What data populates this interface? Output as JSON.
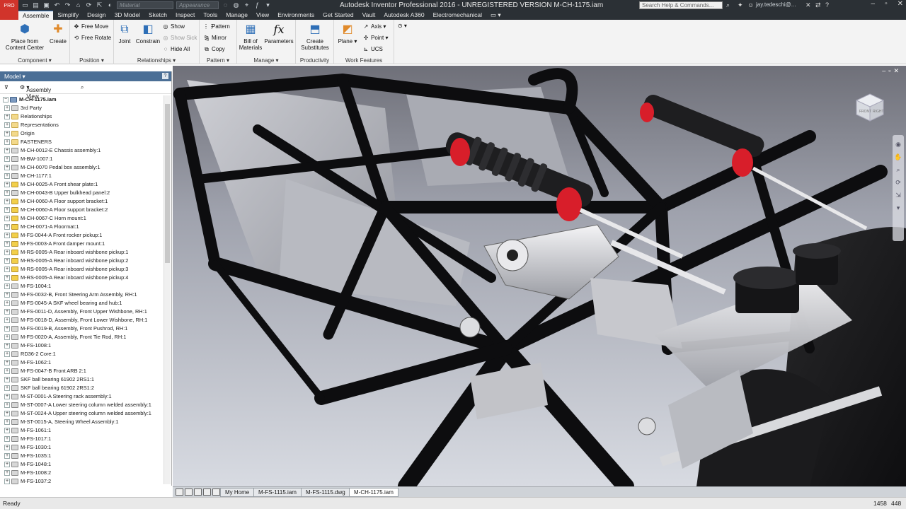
{
  "title_bar": {
    "app_title": "Autodesk Inventor Professional 2016 - UNREGISTERED VERSION    M-CH-1175.iam",
    "logo_text": "PRO",
    "material_placeholder": "Material",
    "appearance_placeholder": "Appearance",
    "help_search_placeholder": "Search Help & Commands...",
    "user_name": "jay.tedeschi@...",
    "help_label": "?"
  },
  "ribbon_tabs": [
    "Assemble",
    "Simplify",
    "Design",
    "3D Model",
    "Sketch",
    "Inspect",
    "Tools",
    "Manage",
    "View",
    "Environments",
    "Get Started",
    "Vault",
    "Autodesk A360",
    "Electromechanical"
  ],
  "ribbon": {
    "component": {
      "title": "Component",
      "place_label": "Place from\nContent Center",
      "create_label": "Create"
    },
    "position": {
      "title": "Position",
      "free_move": "Free Move",
      "free_rotate": "Free Rotate"
    },
    "relationships": {
      "title": "Relationships",
      "joint": "Joint",
      "constrain": "Constrain",
      "show": "Show",
      "show_sick": "Show Sick",
      "hide_all": "Hide All"
    },
    "pattern": {
      "title": "Pattern",
      "pattern": "Pattern",
      "mirror": "Mirror",
      "copy": "Copy"
    },
    "manage": {
      "title": "Manage",
      "bom": "Bill of\nMaterials",
      "parameters": "Parameters"
    },
    "productivity": {
      "title": "Productivity",
      "create_substitutes": "Create\nSubstitutes"
    },
    "work_features": {
      "title": "Work Features",
      "plane": "Plane",
      "axis": "Axis",
      "point": "Point",
      "ucs": "UCS"
    }
  },
  "browser": {
    "header": "Model",
    "view_selector": "Assembly View",
    "help": "?",
    "tree": [
      {
        "label": "M-CH-1175.iam",
        "type": "root"
      },
      {
        "label": "3rd Party",
        "type": "grp"
      },
      {
        "label": "Relationships",
        "type": "fold"
      },
      {
        "label": "Representations",
        "type": "fold"
      },
      {
        "label": "Origin",
        "type": "fold"
      },
      {
        "label": "FASTENERS",
        "type": "fold"
      },
      {
        "label": "M-CH-0012-E Chassis assembly:1",
        "type": "grp"
      },
      {
        "label": "M-BW-1007:1",
        "type": "grp"
      },
      {
        "label": "M-CH-0070 Pedal box assembly:1",
        "type": "grp"
      },
      {
        "label": "M-CH-1177:1",
        "type": "grp"
      },
      {
        "label": "M-CH-0025-A Front shear plate:1",
        "type": "part"
      },
      {
        "label": "M-CH-0043-B Upper bulkhead panel:2",
        "type": "grp"
      },
      {
        "label": "M-CH-0060-A Floor support bracket:1",
        "type": "part"
      },
      {
        "label": "M-CH-0060-A Floor support bracket:2",
        "type": "part"
      },
      {
        "label": "M-CH-0067-C Horn mount:1",
        "type": "part"
      },
      {
        "label": "M-CH-0071-A Floormat:1",
        "type": "part"
      },
      {
        "label": "M-FS-0044-A Front rocker pickup:1",
        "type": "part"
      },
      {
        "label": "M-FS-0003-A Front damper mount:1",
        "type": "part"
      },
      {
        "label": "M-RS-0005-A Rear inboard wishbone pickup:1",
        "type": "part"
      },
      {
        "label": "M-RS-0005-A Rear inboard wishbone pickup:2",
        "type": "part"
      },
      {
        "label": "M-RS-0005-A Rear inboard wishbone pickup:3",
        "type": "part"
      },
      {
        "label": "M-RS-0005-A Rear inboard wishbone pickup:4",
        "type": "part"
      },
      {
        "label": "M-FS-1004:1",
        "type": "grp"
      },
      {
        "label": "M-FS-0032-B, Front Steering Arm Assembly, RH:1",
        "type": "grp"
      },
      {
        "label": "M-FS-0045-A SKF wheel bearing and hub:1",
        "type": "grp"
      },
      {
        "label": "M-FS-0011-D, Assembly, Front Upper Wishbone, RH:1",
        "type": "grp"
      },
      {
        "label": "M-FS-0018-D, Assembly, Front Lower Wishbone, RH:1",
        "type": "grp"
      },
      {
        "label": "M-FS-0019-B, Assembly, Front Pushrod, RH:1",
        "type": "grp"
      },
      {
        "label": "M-FS-0020-A, Assembly, Front Tie Rod, RH:1",
        "type": "grp"
      },
      {
        "label": "M-FS-1008:1",
        "type": "grp"
      },
      {
        "label": "RD36-2 Core:1",
        "type": "grp"
      },
      {
        "label": "M-FS-1062:1",
        "type": "grp"
      },
      {
        "label": "M-FS-0047-B Front ARB 2:1",
        "type": "grp"
      },
      {
        "label": "SKF ball bearing 61902 2RS1:1",
        "type": "grp"
      },
      {
        "label": "SKF ball bearing 61902 2RS1:2",
        "type": "grp"
      },
      {
        "label": "M-ST-0001-A Steering rack assembly:1",
        "type": "grp"
      },
      {
        "label": "M-ST-0007-A Lower steering column welded assembly:1",
        "type": "grp"
      },
      {
        "label": "M-ST-0024-A Upper steering column welded assembly:1",
        "type": "grp"
      },
      {
        "label": "M-ST-0015-A, Steering Wheel Assembly:1",
        "type": "grp"
      },
      {
        "label": "M-FS-1061:1",
        "type": "grp"
      },
      {
        "label": "M-FS-1017:1",
        "type": "grp"
      },
      {
        "label": "M-FS-1030:1",
        "type": "grp"
      },
      {
        "label": "M-FS-1035:1",
        "type": "grp"
      },
      {
        "label": "M-FS-1048:1",
        "type": "grp"
      },
      {
        "label": "M-FS-1008:2",
        "type": "grp"
      },
      {
        "label": "M-FS-1037:2",
        "type": "grp"
      }
    ]
  },
  "viewcube": {
    "top": "TOP",
    "front": "FRONT",
    "right": "RIGHT"
  },
  "doc_tabs": [
    "My Home",
    "M-FS-1115.iam",
    "M-FS-1115.dwg",
    "M-CH-1175.iam"
  ],
  "status": {
    "text": "Ready",
    "count_a": "1458",
    "count_b": "448"
  },
  "colors": {
    "titlebar": "#2b3035",
    "ribbon": "#f3f3f3",
    "browser_header": "#4b6f96",
    "frame_tube": "#111111",
    "damper_red": "#d81e2a"
  }
}
